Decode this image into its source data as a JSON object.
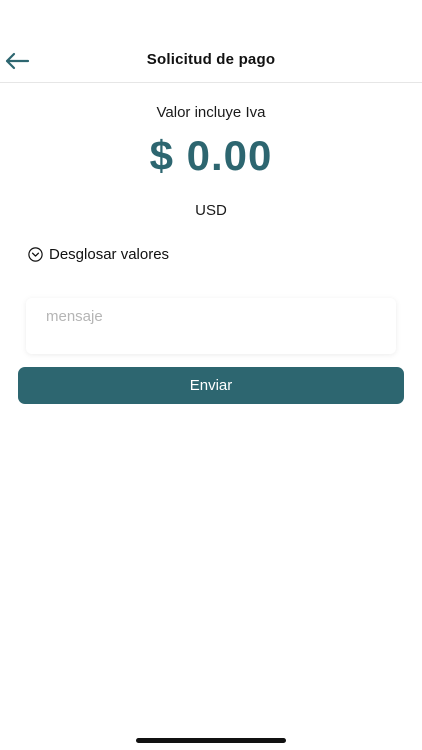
{
  "header": {
    "title": "Solicitud de pago",
    "back_icon": "arrow-left-icon"
  },
  "payment": {
    "subtitle": "Valor incluye Iva",
    "amount": "$ 0.00",
    "currency": "USD",
    "amount_color": "#2d6670"
  },
  "breakdown": {
    "label": "Desglosar valores",
    "icon": "chevron-down-circle-icon"
  },
  "message": {
    "placeholder": "mensaje",
    "value": ""
  },
  "send_button": {
    "label": "Enviar",
    "color": "#2d6670"
  }
}
